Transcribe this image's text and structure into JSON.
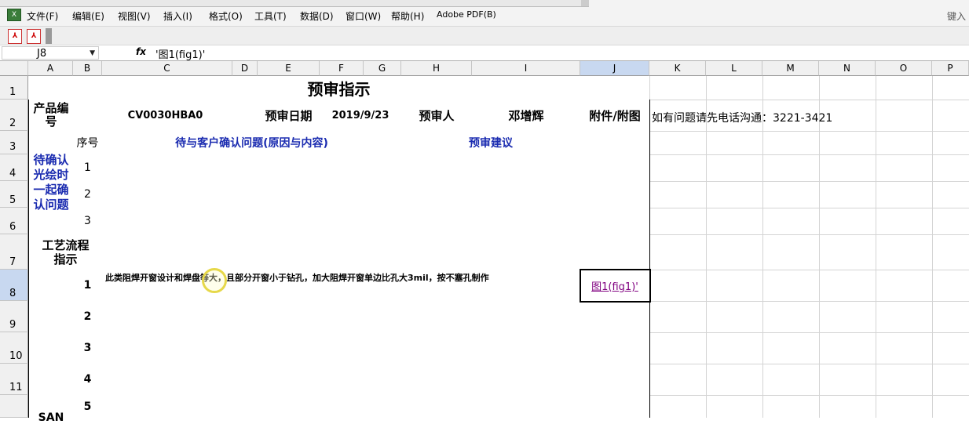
{
  "menu": [
    "文件(F)",
    "编辑(E)",
    "视图(V)",
    "插入(I)",
    "格式(O)",
    "工具(T)",
    "数据(D)",
    "窗口(W)",
    "帮助(H)",
    "Adobe PDF(B)"
  ],
  "ask_box": "键入",
  "name_box": "J8",
  "fx_label": "fx",
  "formula": "'图1(fig1)'",
  "columns": [
    "A",
    "B",
    "C",
    "D",
    "E",
    "F",
    "G",
    "H",
    "I",
    "J",
    "K",
    "L",
    "M",
    "N",
    "O",
    "P"
  ],
  "rows": [
    "1",
    "2",
    "3",
    "4",
    "5",
    "6",
    "7",
    "8",
    "9",
    "10",
    "11"
  ],
  "sheet": {
    "title": "预审指示",
    "product_no_label": "产品编号",
    "product_no": "CV0030HBA0",
    "review_date_label": "预审日期",
    "review_date": "2019/9/23",
    "reviewer_label": "预审人",
    "reviewer": "邓增辉",
    "attachment_label": "附件/附图",
    "note": "如有问题请先电话沟通：3221-3421",
    "seq_label": "序号",
    "customer_issue_header": "待与客户确认问题(原因与内容)",
    "suggestion_header": "预审建议",
    "pending_label": "待确认光绘时一起确认问题",
    "pending_seq": [
      "1",
      "2",
      "3"
    ],
    "process_label": "工艺流程指示",
    "process_seq": [
      "1",
      "2",
      "3",
      "4",
      "5"
    ],
    "process_item_1": "此类阻焊开窗设计和焊盘等大，且部分开窗小于钻孔，加大阻焊开窗单边比孔大3mil，按不塞孔制作",
    "attachment_link": "图1(fig1)'",
    "partial_label": "SAN"
  }
}
